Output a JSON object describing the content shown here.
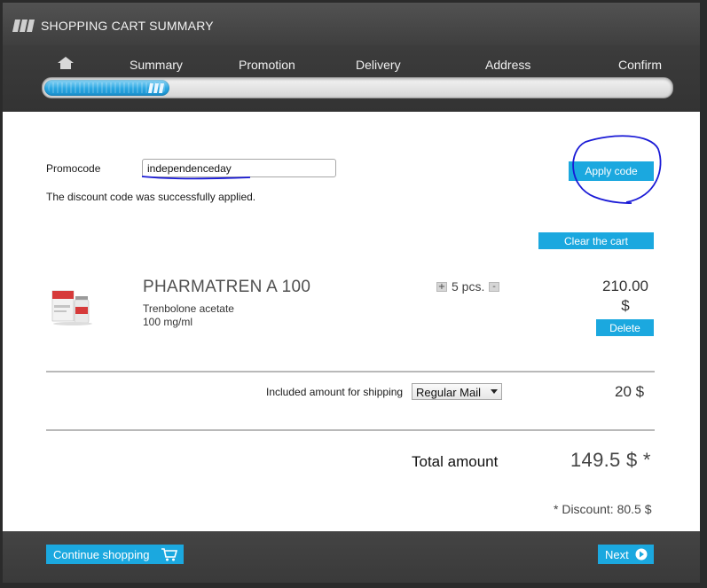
{
  "header": {
    "title": "SHOPPING CART SUMMARY",
    "steps": [
      "Summary",
      "Promotion",
      "Delivery",
      "Address",
      "Confirm"
    ],
    "progress_fraction": 0.2
  },
  "promo": {
    "label": "Promocode",
    "value": "independenceday",
    "apply_label": "Apply code",
    "success_message": "The discount code was successfully applied."
  },
  "cart": {
    "clear_label": "Clear the cart",
    "item": {
      "name": "PHARMATREN A 100",
      "substance": "Trenbolone acetate",
      "concentration": "100 mg/ml",
      "qty_plus": "+",
      "qty_minus": "-",
      "quantity": "5 pcs.",
      "price": "210.00",
      "currency": "$",
      "delete_label": "Delete"
    }
  },
  "shipping": {
    "label": "Included amount for shipping",
    "selected": "Regular Mail",
    "cost": "20 $"
  },
  "totals": {
    "label": "Total amount",
    "value": "149.5 $ *",
    "discount": "* Discount: 80.5 $"
  },
  "footer": {
    "continue_label": "Continue shopping",
    "next_label": "Next"
  },
  "colors": {
    "accent": "#1ba8df",
    "annotation": "#1a1ad6"
  }
}
